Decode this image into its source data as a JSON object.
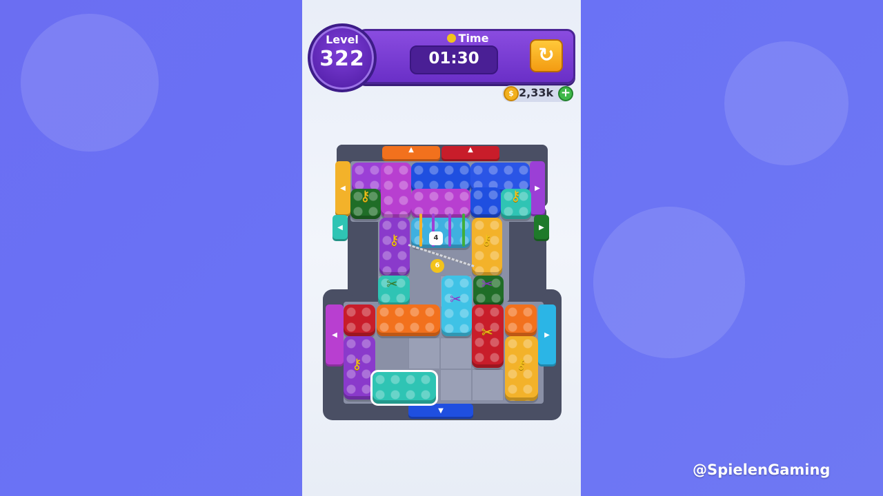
{
  "header": {
    "level_label": "Level",
    "level_number": "322",
    "time_label": "Time",
    "time_value": "01:30",
    "restart_icon": "restart-icon",
    "coins": "2,33k",
    "coin_icon": "coin-icon",
    "add_coins_icon": "plus-icon"
  },
  "board": {
    "lock_chain_counts": [
      "4",
      "6"
    ],
    "key_icon": "key-icon",
    "scissors_icon": "scissors-icon",
    "exit_gate_icons": [
      "arrow-up-icon",
      "arrow-left-icon",
      "arrow-right-icon",
      "arrow-down-icon"
    ]
  },
  "colors": {
    "purple": "#9b3fd6",
    "blue": "#1f4fe0",
    "magenta": "#b83fd0",
    "teal": "#2fc4b4",
    "dark_green": "#1f7a2a",
    "yellow": "#f3b22a",
    "orange": "#f2711d",
    "red": "#d01f2a",
    "cyan": "#2bb5e6"
  },
  "watermark": "@SpielenGaming"
}
